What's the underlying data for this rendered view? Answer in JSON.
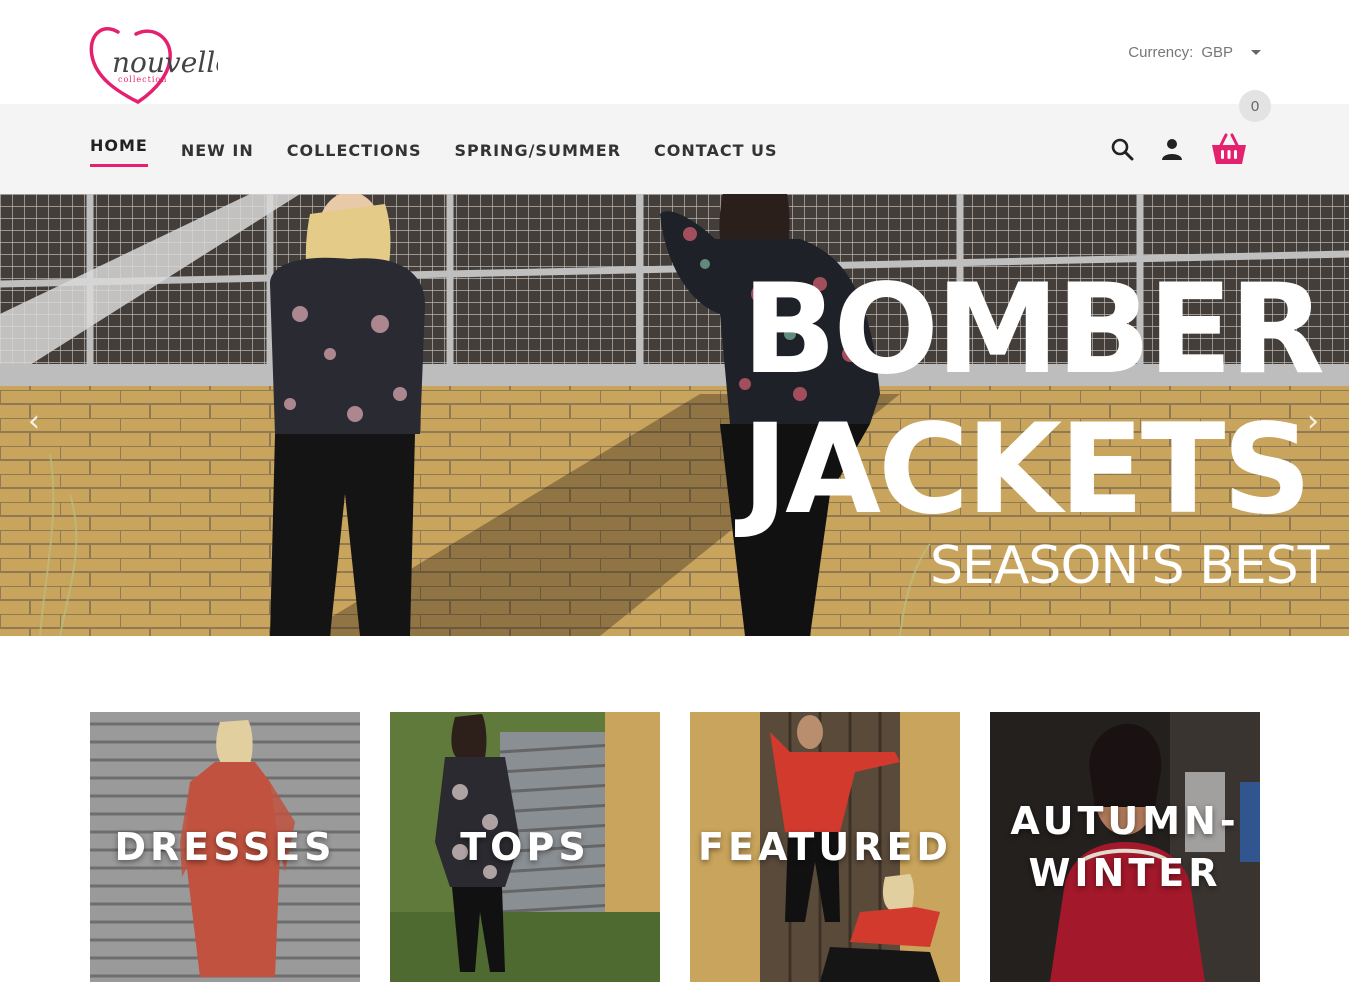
{
  "brand": {
    "logo_text": "nouvelle",
    "logo_subtext": "collection"
  },
  "currency": {
    "label": "Currency:",
    "value": "GBP"
  },
  "nav": {
    "items": [
      {
        "label": "HOME",
        "active": true
      },
      {
        "label": "NEW IN",
        "active": false
      },
      {
        "label": "COLLECTIONS",
        "active": false
      },
      {
        "label": "SPRING/SUMMER",
        "active": false
      },
      {
        "label": "CONTACT US",
        "active": false
      }
    ],
    "icons": [
      "search-icon",
      "user-icon",
      "basket-icon"
    ],
    "cart_count": "0",
    "accent_color": "#e5206f"
  },
  "hero": {
    "title_line1": "BOMBER",
    "title_line2": "JACKETS",
    "subtitle": "SEASON'S BEST",
    "prev_glyph": "‹",
    "next_glyph": "›"
  },
  "categories": [
    {
      "label": "DRESSES"
    },
    {
      "label": "TOPS"
    },
    {
      "label": "FEATURED"
    },
    {
      "label": "AUTUMN-WINTER"
    }
  ]
}
